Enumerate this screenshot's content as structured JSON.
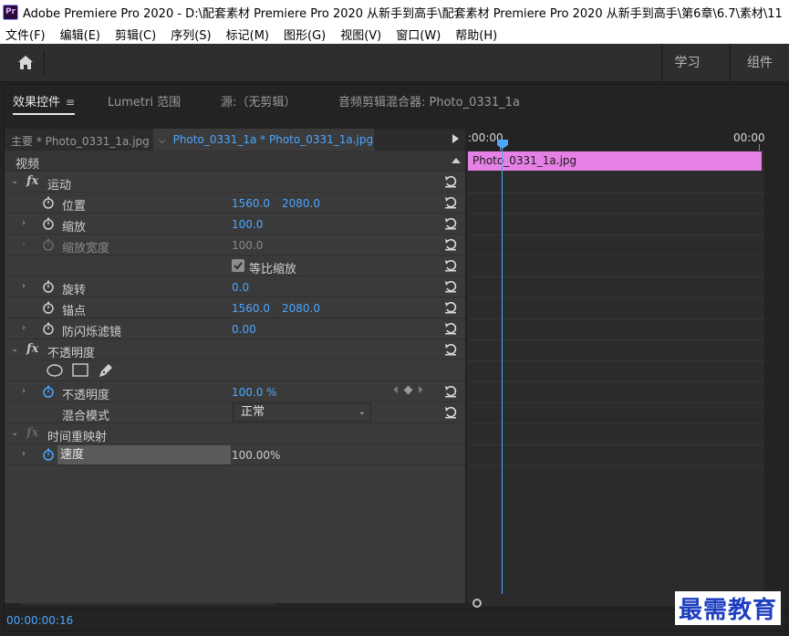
{
  "window": {
    "app_icon": "Pr",
    "title": "Adobe Premiere Pro 2020 - D:\\配套素材 Premiere Pro 2020 从新手到高手\\配套素材 Premiere Pro 2020 从新手到高手\\第6章\\6.7\\素材\\11"
  },
  "menu": [
    "文件(F)",
    "编辑(E)",
    "剪辑(C)",
    "序列(S)",
    "标记(M)",
    "图形(G)",
    "视图(V)",
    "窗口(W)",
    "帮助(H)"
  ],
  "header": {
    "home_icon": "home-icon",
    "workspaces": [
      "学习",
      "组件"
    ]
  },
  "panel": {
    "tabs": [
      "效果控件",
      "Lumetri 范围",
      "源:（无剪辑）",
      "音频剪辑混合器: Photo_0331_1a"
    ],
    "tab_menu_icon": "≡"
  },
  "clip": {
    "master_label": "主要 * Photo_0331_1a.jpg",
    "sequence_label": "Photo_0331_1a * Photo_0331_1a.jpg"
  },
  "effects": {
    "video_label": "视频",
    "motion": {
      "label": "运动",
      "position": {
        "label": "位置",
        "x": "1560.0",
        "y": "2080.0"
      },
      "scale": {
        "label": "缩放",
        "value": "100.0"
      },
      "scale_width": {
        "label": "缩放宽度",
        "value": "100.0"
      },
      "uniform_scale": {
        "label": "等比缩放",
        "checked": true
      },
      "rotation": {
        "label": "旋转",
        "value": "0.0"
      },
      "anchor": {
        "label": "锚点",
        "x": "1560.0",
        "y": "2080.0"
      },
      "anti_flicker": {
        "label": "防闪烁滤镜",
        "value": "0.00"
      }
    },
    "opacity": {
      "label": "不透明度",
      "opacity": {
        "label": "不透明度",
        "value": "100.0 %"
      },
      "blend_mode": {
        "label": "混合模式",
        "value": "正常"
      }
    },
    "time_remap": {
      "label": "时间重映射",
      "speed": {
        "label": "速度",
        "value": "100.00%"
      }
    }
  },
  "timeline": {
    "start_tc": ":00:00",
    "end_tc": "00:00",
    "clip_name": "Photo_0331_1a.jpg"
  },
  "status": {
    "timecode": "00:00:00:16"
  },
  "watermark": "最需教育",
  "colors": {
    "accent_blue": "#4da6ff",
    "clip_pink": "#e581e5",
    "panel_bg": "#3a3a3a"
  }
}
